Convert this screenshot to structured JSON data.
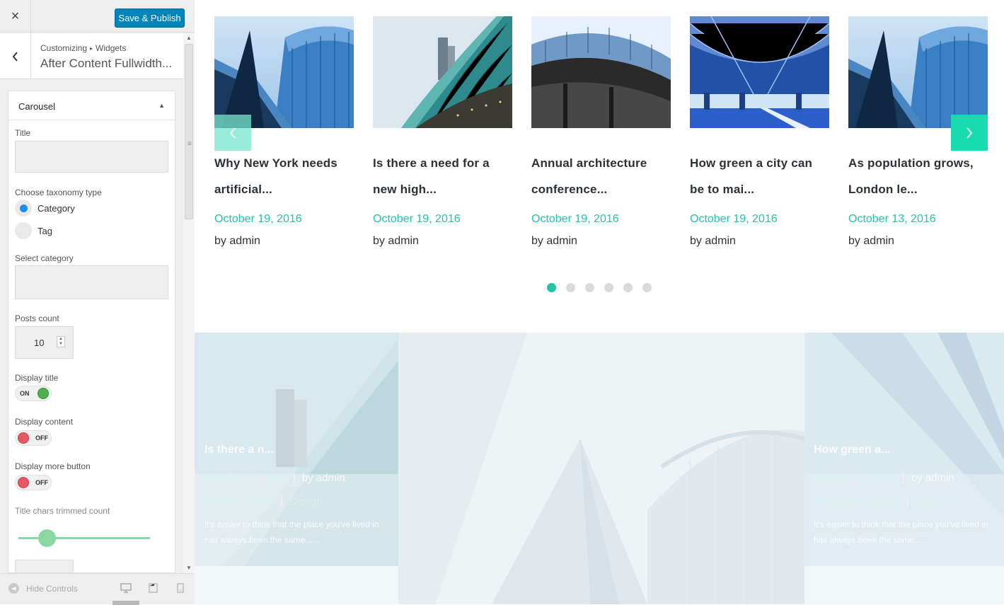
{
  "customizer": {
    "close_label": "×",
    "publish_label": "Save & Publish",
    "breadcrumb": [
      "Customizing",
      "Widgets"
    ],
    "breadcrumb_sep": "▸",
    "panel_title": "After Content Fullwidth...",
    "widget": {
      "name": "Carousel",
      "toggle_icon": "▲",
      "title_label": "Title",
      "title_value": "",
      "taxonomy_label": "Choose taxonomy type",
      "taxonomy_options": [
        "Category",
        "Tag"
      ],
      "taxonomy_selected": "Category",
      "category_label": "Select category",
      "category_value": "",
      "posts_count_label": "Posts count",
      "posts_count": "10",
      "display_title_label": "Display title",
      "display_title": "ON",
      "display_content_label": "Display content",
      "display_content": "OFF",
      "display_more_label": "Display more button",
      "display_more": "OFF",
      "trim_label": "Title chars trimmed count",
      "trim_slider_fraction": 0.22
    },
    "footer": {
      "hide_controls": "Hide Controls",
      "devices": [
        "desktop-icon",
        "tablet-icon",
        "mobile-icon"
      ],
      "active_device": "desktop-icon"
    }
  },
  "carousel": {
    "accent": "#21c4a8",
    "posts": [
      {
        "title": "Why New York needs artificial...",
        "date": "October 19, 2016",
        "author": "by admin"
      },
      {
        "title": "Is there a need for a new high...",
        "date": "October 19, 2016",
        "author": "by admin"
      },
      {
        "title": "Annual architecture conference...",
        "date": "October 19, 2016",
        "author": "by admin"
      },
      {
        "title": "How green a city can be to mai...",
        "date": "October 19, 2016",
        "author": "by admin"
      },
      {
        "title": "As population grows, London le...",
        "date": "October 13, 2016",
        "author": "by admin"
      }
    ],
    "dots_count": 6,
    "active_dot": 1
  },
  "lower_posts": [
    {
      "title": "Is there a n...",
      "date": "October 19, 2016",
      "author": "by admin",
      "categories": [
        "Garden design",
        "Design"
      ],
      "excerpt": "It's easier to think that the place you've lived in has always been the same......"
    },
    {
      "title": "How green a...",
      "date": "October 19, 2016",
      "author": "by admin",
      "categories": [
        "Landscape design",
        "Interior"
      ],
      "excerpt": "It's easier to think that the place you've lived in has always been the same......"
    }
  ]
}
